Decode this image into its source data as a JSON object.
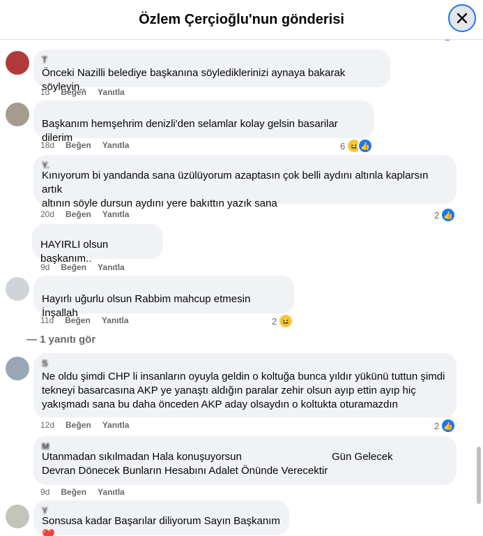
{
  "header": {
    "title": "Özlem Çerçioğlu'nun gönderisi"
  },
  "comments": [
    {
      "author": "T      ",
      "text": "Önceki Nazilli belediye başkanına söylediklerinizi aynaya bakarak söyleyin..",
      "time": "1d",
      "like": "Beğen",
      "reply": "Yanıtla",
      "reactions": ""
    },
    {
      "author": "         ",
      "text": "Başkanım hemşehrim denizli'den selamlar kolay gelsin basarilar dilerim",
      "time": "18d",
      "like": "Beğen",
      "reply": "Yanıtla",
      "reactions": "6"
    },
    {
      "author": "Y.",
      "text": "Kınıyorum bi yandanda sana üzülüyorum azaptasın çok belli aydını altınla kaplarsın artık\naltının söyle dursun aydını yere bakıttın yazık sana",
      "time": "20d",
      "like": "Beğen",
      "reply": "Yanıtla",
      "reactions": "2"
    },
    {
      "author": "       ",
      "text": "HAYIRLI olsun başkanım..",
      "time": "9d",
      "like": "Beğen",
      "reply": "Yanıtla",
      "reactions": ""
    },
    {
      "author": "          ",
      "text": "Hayırlı uğurlu olsun Rabbim mahcup etmesin İnşallah",
      "time": "11d",
      "like": "Beğen",
      "reply": "Yanıtla",
      "reactions": "2"
    },
    {
      "author": "S       ",
      "text": "Ne oldu şimdi CHP li insanların oyuyla geldin o koltuğa bunca yıldır yükünü tuttun şimdi\ntekneyi basarcasına AKP ye yanaştı aldığın paralar zehir olsun ayıp ettin ayıp hiç\nyakışmadı sana bu daha önceden AKP aday olsaydın o koltukta oturamazdın",
      "time": "12d",
      "like": "Beğen",
      "reply": "Yanıtla",
      "reactions": "2"
    },
    {
      "author": "M        ",
      "text": "Utanmadan sıkılmadan Hala konuşuyorsun                               Gün Gelecek\nDevran Dönecek Bunların Hesabını Adalet Önünde Verecektir",
      "time": "9d",
      "like": "Beğen",
      "reply": "Yanıtla",
      "reactions": ""
    },
    {
      "author": "Y       ",
      "text": "Sonsusa kadar Başarılar diliyorum Sayın Başkanım❤️",
      "time": "",
      "like": "",
      "reply": "",
      "reactions": ""
    }
  ],
  "view_replies": "— 1 yanıtı gör",
  "colors": {
    "accent": "#1877f2",
    "bubble": "#f0f2f5",
    "meta": "#65676b"
  }
}
